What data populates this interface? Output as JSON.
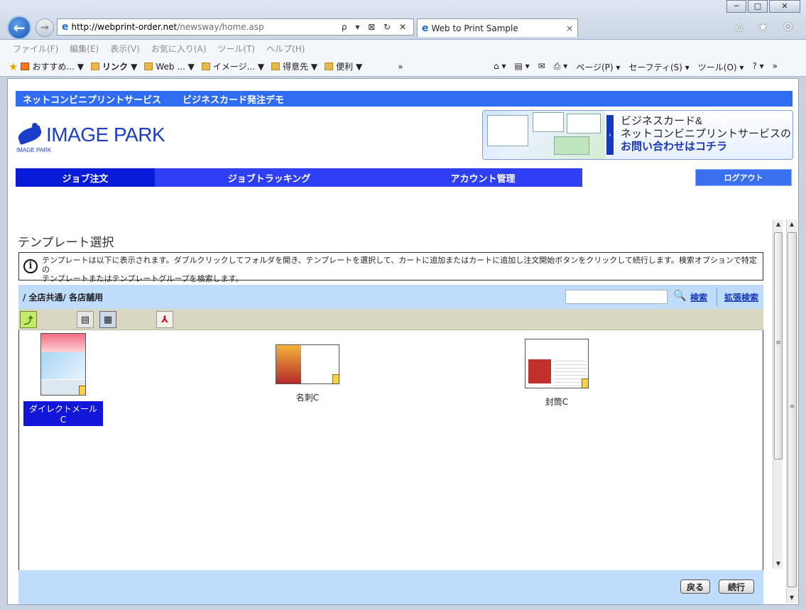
{
  "browser": {
    "url_host": "http://webprint-order.net",
    "url_path": "/newsway/home.asp",
    "address_tools": "ρ ▾ ⊠ ↻ ✕",
    "tab_title": "Web to Print Sample",
    "tab_close": "×",
    "window_controls": {
      "minimize": "─",
      "maximize": "□",
      "close": "✕"
    },
    "back_glyph": "←",
    "forward_glyph": "→",
    "menu": [
      "ファイル(F)",
      "編集(E)",
      "表示(V)",
      "お気に入り(A)",
      "ツール(T)",
      "ヘルプ(H)"
    ],
    "favorites": {
      "recommended": "おすすめ... ▼",
      "links": "リンク ▼",
      "web": "Web ... ▼",
      "image": "イメージ... ▼",
      "clients": "得意先 ▼",
      "useful": "便利 ▼",
      "overflow": "»"
    },
    "command_bar": {
      "home": "⌂ ▾",
      "feeds": "▤ ▾",
      "mail": "✉",
      "print": "⎙ ▾",
      "page": "ページ(P) ▾",
      "safety": "セーフティ(S) ▾",
      "tools": "ツール(O) ▾",
      "help": "? ▾",
      "overflow": "»"
    },
    "right_icons": "⌂ ★ ⚙",
    "icons": [
      "back-icon",
      "forward-icon",
      "ie-icon",
      "home-icon",
      "star-icon",
      "gear-icon"
    ]
  },
  "site": {
    "header_links": [
      "ネットコンビニプリントサービス",
      "ビジネスカード発注デモ"
    ],
    "logo_text": "IMAGE PARK",
    "logo_sub": "IMAGE PARK",
    "banner": {
      "arrow": "›",
      "line1": "ビジネスカード&",
      "line2": "ネットコンビニプリントサービスの",
      "line3": "お問い合わせはコチラ"
    },
    "nav": [
      {
        "label": "ジョブ注文",
        "active": true
      },
      {
        "label": "ジョブトラッキング",
        "active": false
      },
      {
        "label": "アカウント管理",
        "active": false
      }
    ],
    "logout": "ログアウト"
  },
  "main": {
    "title": "テンプレート選択",
    "info_icon": "i",
    "info_lines": [
      "テンプレートは以下に表示されます。ダブルクリックしてフォルダを開き、テンプレートを選択して、カートに追加またはカートに追加し注文開始ボタンをクリックして続行します。検索オプションで特定の",
      "テンプレートまたはテンプレートグループを検索します。"
    ],
    "breadcrumb": "/ 全店共通/ 各店舗用",
    "search_placeholder": "",
    "search_icon": "🔍",
    "search_link": "検索",
    "advanced_search_link": "拡張検索",
    "toolbar_glyphs": {
      "up": "⤴",
      "list": "▤",
      "thumbs": "▦",
      "pdf": "⅄"
    },
    "files": [
      {
        "label": "ダイレクトメールC",
        "selected": true
      },
      {
        "label": "名刺C",
        "selected": false
      },
      {
        "label": "封筒C",
        "selected": false
      }
    ],
    "back_button": "戻る",
    "continue_button": "続行"
  },
  "scrollbar": {
    "up": "▲",
    "down": "▼",
    "grip": "≡"
  }
}
